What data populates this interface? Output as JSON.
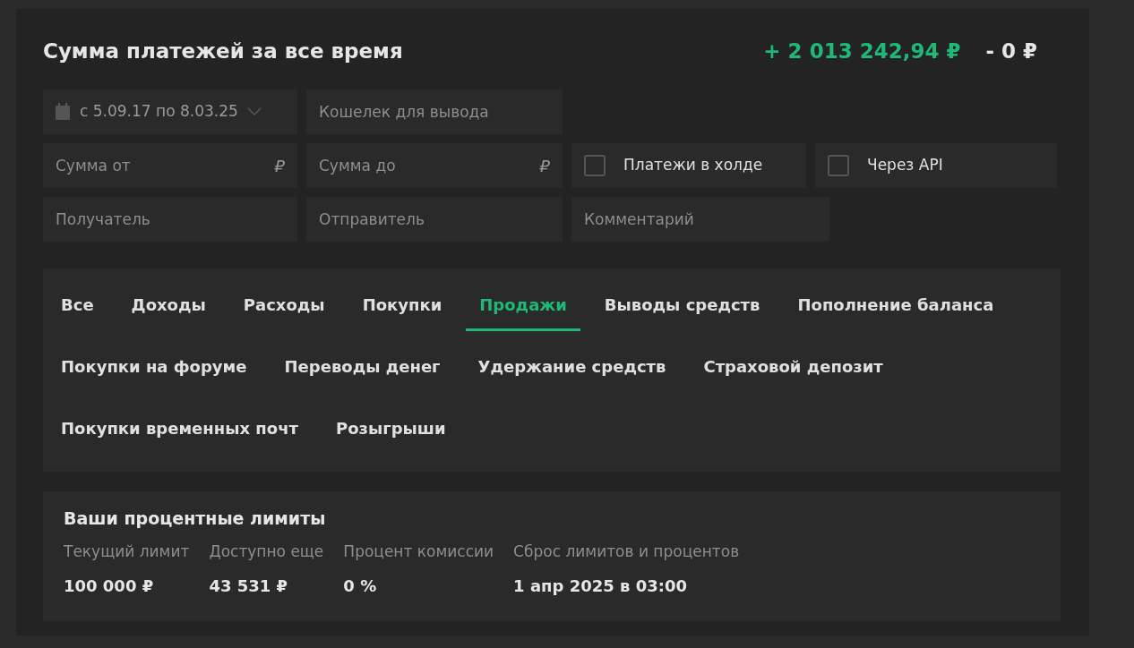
{
  "title": "Сумма платежей за все время",
  "totals": {
    "income": "+ 2 013 242,94 ₽",
    "expense": "- 0 ₽"
  },
  "filters": [
    [
      {
        "kind": "date",
        "value": "с 5.09.17 по 8.03.25"
      },
      {
        "kind": "input",
        "placeholder": "Кошелек для вывода"
      }
    ],
    [
      {
        "kind": "input",
        "placeholder": "Сумма от",
        "suffix": "₽"
      },
      {
        "kind": "input",
        "placeholder": "Сумма до",
        "suffix": "₽"
      },
      {
        "kind": "checkbox",
        "label": "Платежи в холде",
        "checked": false
      },
      {
        "kind": "checkbox",
        "label": "Через API",
        "checked": false
      }
    ],
    [
      {
        "kind": "input",
        "placeholder": "Получатель"
      },
      {
        "kind": "input",
        "placeholder": "Отправитель"
      },
      {
        "kind": "input",
        "placeholder": "Комментарий"
      }
    ]
  ],
  "tabs": [
    {
      "label": "Все",
      "selected": false
    },
    {
      "label": "Доходы",
      "selected": false
    },
    {
      "label": "Расходы",
      "selected": false
    },
    {
      "label": "Покупки",
      "selected": false
    },
    {
      "label": "Продажи",
      "selected": true
    },
    {
      "label": "Выводы средств",
      "selected": false
    },
    {
      "label": "Пополнение баланса",
      "selected": false
    },
    {
      "label": "Покупки на форуме",
      "selected": false
    },
    {
      "label": "Переводы денег",
      "selected": false
    },
    {
      "label": "Удержание средств",
      "selected": false
    },
    {
      "label": "Страховой депозит",
      "selected": false
    },
    {
      "label": "Покупки временных почт",
      "selected": false
    },
    {
      "label": "Розыгрыши",
      "selected": false
    }
  ],
  "limits": {
    "title": "Ваши процентные лимиты",
    "items": [
      {
        "label": "Текущий лимит",
        "value": "100 000 ₽"
      },
      {
        "label": "Доступно еще",
        "value": "43 531 ₽"
      },
      {
        "label": "Процент комиссии",
        "value": "0 %"
      },
      {
        "label": "Сброс лимитов и процентов",
        "value": "1 апр 2025 в 03:00"
      }
    ]
  }
}
